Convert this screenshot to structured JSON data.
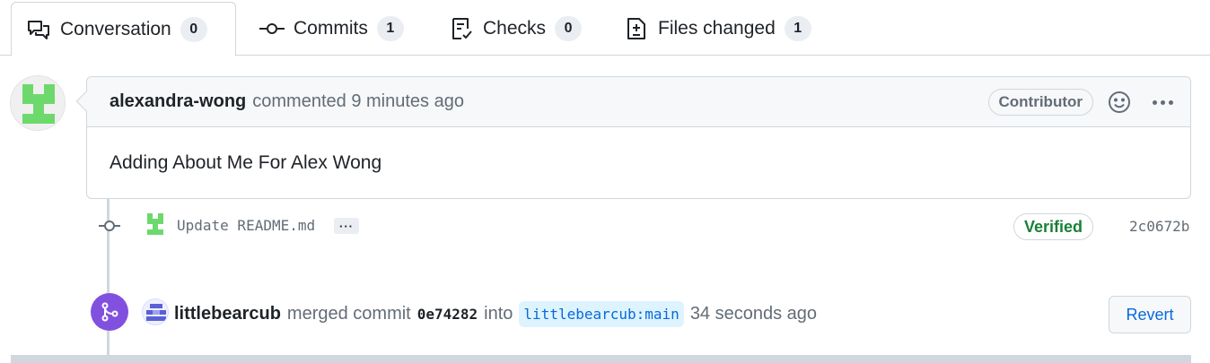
{
  "tabs": [
    {
      "label": "Conversation",
      "count": "0",
      "icon": "comment-discussion-icon"
    },
    {
      "label": "Commits",
      "count": "1",
      "icon": "git-commit-icon"
    },
    {
      "label": "Checks",
      "count": "0",
      "icon": "checklist-icon"
    },
    {
      "label": "Files changed",
      "count": "1",
      "icon": "file-diff-icon"
    }
  ],
  "comment": {
    "author": "alexandra-wong",
    "meta": "commented 9 minutes ago",
    "badge": "Contributor",
    "body": "Adding About Me For Alex Wong"
  },
  "commit": {
    "message": "Update README.md",
    "ellipsis": "···",
    "verified": "Verified",
    "sha": "2c0672b"
  },
  "merge": {
    "user": "littlebearcub",
    "action": "merged commit",
    "sha": "0e74282",
    "into": "into",
    "branch": "littlebearcub:main",
    "time": "34 seconds ago",
    "revert_label": "Revert"
  },
  "colors": {
    "accent": "#0969da",
    "merged": "#8250df",
    "verified": "#1a7f37",
    "identicon_green": "#6dd96d",
    "identicon_blue": "#5b5fd6"
  }
}
